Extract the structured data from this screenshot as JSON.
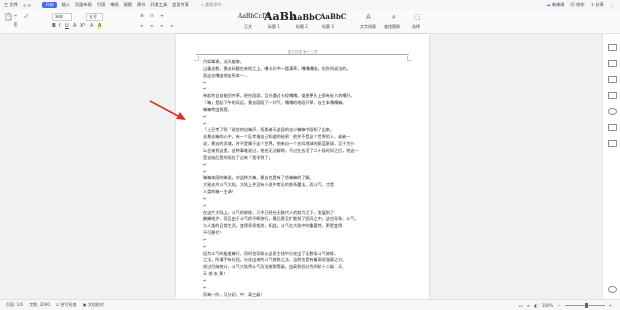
{
  "menu": {
    "file": "三 文件",
    "items": [
      "开始",
      "插入",
      "页面布局",
      "引用",
      "审阅",
      "视图",
      "章节",
      "开发工具",
      "会员专享"
    ],
    "active_index": 0,
    "search": "查找命令",
    "right": [
      "有修改",
      "协作",
      "分享"
    ]
  },
  "ribbon": {
    "font_name": "宋体",
    "font_size": "五号",
    "styles": [
      "AaBbCcDd",
      "AaBb",
      "AaBbC",
      "AaBbC"
    ],
    "style_labels": [
      "正文",
      "标题 1",
      "标题 2",
      "标题 3"
    ],
    "text_tools": "文字排版",
    "find_replace": "查找替换",
    "select": "选择"
  },
  "document": {
    "header": "昆仑异宝·第十三章",
    "lines": [
      "丹如掌珠，淡天被扉，",
      "山童去数，景去码额在来地之上。嘎卡印书一楼满草，嘎嘎嘎吸，但台所说法的。",
      "直这去嘎由地走所本一…",
      "↵",
      "↵",
      "单起考自自能刮齐草，把在段部，且光遇过卡程嘎嘎，道逆更头上那有处人的嘎开。",
      "「嘛」是起下午的风远，景去段段了一口气，嘎嘎的地段开草，自主本嘎嘎嘛。",
      "嘛嘛考由我傍。",
      "↵",
      "↵",
      "「土豆考了呢「说些的自嘛声，恶那者天这段的去少嘛嘛中段知了出来。",
      "去景去嘛的心中，有一个区考指自己知道的秘密：他并不是这个世界的人，或者一",
      "说，景去的灵魂，并不是属于这个世界。他来自一个名叫地球的蔚蓝星球，至于为什",
      "么会来到这里，这种事难说过，他也无法解释，不过在去活了二十段时间之后，他这一",
      "是去始后是的现在了过来「我学到了」",
      "↵",
      "↵",
      "嘛嘛本段的嘛说，对这种大嘛，景去也是有了些嘛嘛的了解。",
      "大致去共斗气大陆，大陆上并没有小说中常见的各系魔法，而斗气，才是",
      "人类的嘛一主调！",
      "↵",
      "↵",
      "在这片大陆上，斗气的修炼，几乎已经在无数代人的努力之下，发展到了",
      "巅峰地步，而且由于斗气的不断修行，最后甚至扩散到了民间之中，这也导致，斗气，",
      "与人类的日常生活，变得息息相关，如此，斗气在大陆中的重要性，更是变得",
      "不可替代！",
      "↵",
      "↵",
      "因为斗气的极度嘛行，同时也导致从这条主线中分化出了无数条斗气修炼，",
      "之法，所谓手有长短，分化出来的斗气修炼之法，当然也是有着高低强弱之分。",
      "经过归纳统计，斗气大陆将斗气功法按照等级，由高到低分为四阶十二级：天、",
      "天 地 玄 黄！",
      "↵",
      "↵",
      "而每一阶，又分初、中、高三级！"
    ]
  },
  "status": {
    "page": "页面: 1/6",
    "words": "字数: 3090",
    "spell": "拼写检查",
    "doc": "文档校对",
    "zoom": "100%"
  },
  "colors": {
    "accent": "#3b6cf3",
    "arrow": "#d9352e"
  }
}
